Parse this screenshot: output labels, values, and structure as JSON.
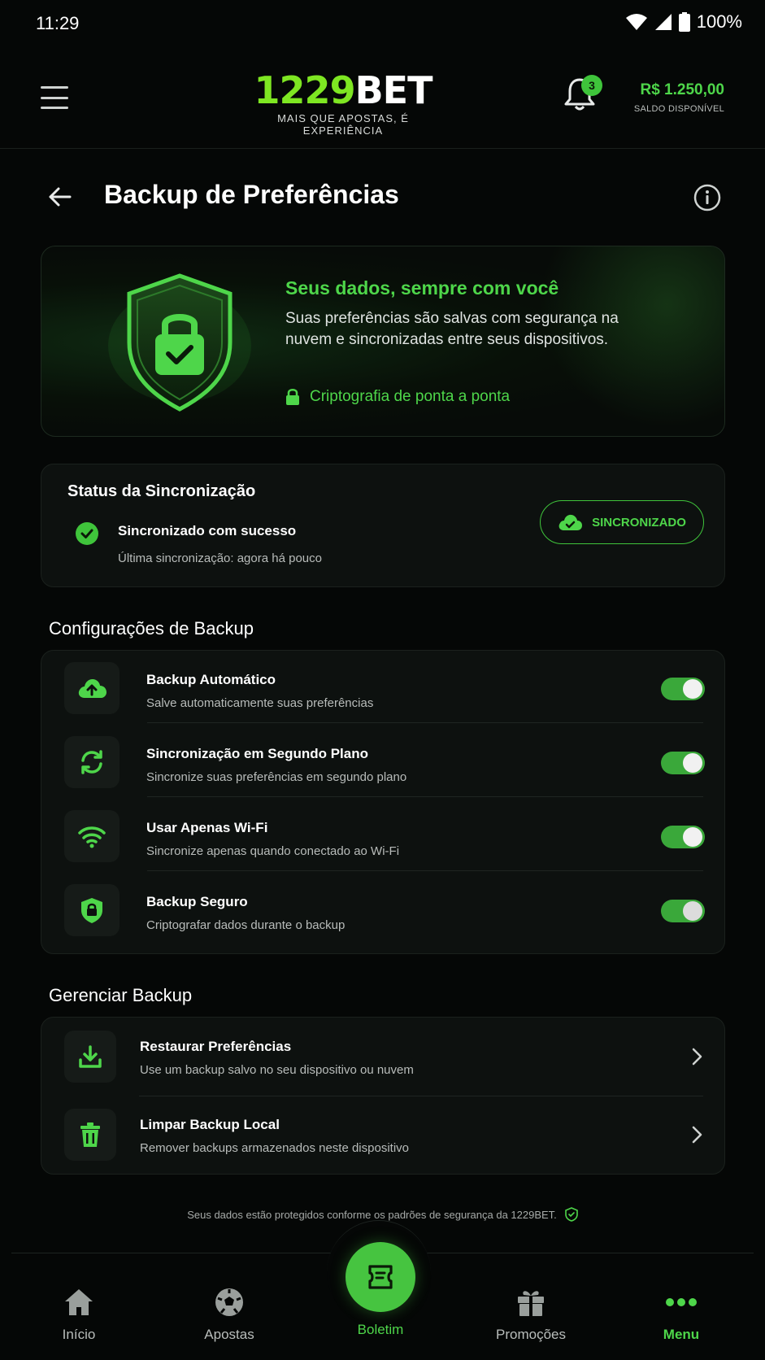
{
  "status_bar": {
    "time": "11:29",
    "battery": "100%"
  },
  "header": {
    "logo_number": "1229",
    "logo_brand": "BET",
    "logo_tagline": "MAIS QUE APOSTAS, É EXPERIÊNCIA",
    "notification_count": "3",
    "balance_amount": "R$ 1.250,00",
    "balance_label": "SALDO DISPONÍVEL"
  },
  "page": {
    "title": "Backup de Preferências"
  },
  "hero": {
    "title": "Seus dados, sempre com você",
    "description": "Suas preferências são salvas com segurança na nuvem e sincronizadas entre seus dispositivos.",
    "encryption": "Criptografia de ponta a ponta"
  },
  "sync": {
    "title": "Status da Sincronização",
    "message": "Sincronizado com sucesso",
    "last_sync": "Última sincronização: agora há pouco",
    "status_pill": "SINCRONIZADO"
  },
  "backup_settings": {
    "heading": "Configurações de Backup",
    "items": [
      {
        "title": "Backup Automático",
        "subtitle": "Salve automaticamente suas preferências",
        "icon": "cloud-upload-icon",
        "enabled": true
      },
      {
        "title": "Sincronização em Segundo Plano",
        "subtitle": "Sincronize suas preferências em segundo plano",
        "icon": "sync-icon",
        "enabled": true
      },
      {
        "title": "Usar Apenas Wi-Fi",
        "subtitle": "Sincronize apenas quando conectado ao Wi-Fi",
        "icon": "wifi-icon",
        "enabled": true
      },
      {
        "title": "Backup Seguro",
        "subtitle": "Criptografar dados durante o backup",
        "icon": "shield-lock-icon",
        "enabled": true
      }
    ]
  },
  "manage_backup": {
    "heading": "Gerenciar Backup",
    "items": [
      {
        "title": "Restaurar Preferências",
        "subtitle": "Use um backup salvo no seu dispositivo ou nuvem",
        "icon": "download-icon"
      },
      {
        "title": "Limpar Backup Local",
        "subtitle": "Remover backups armazenados neste dispositivo",
        "icon": "trash-icon"
      }
    ]
  },
  "footer_note": "Seus dados estão protegidos conforme os padrões de segurança da 1229BET.",
  "bottom_nav": {
    "items": [
      {
        "label": "Início",
        "icon": "home-icon"
      },
      {
        "label": "Apostas",
        "icon": "soccer-ball-icon"
      },
      {
        "label": "Boletim",
        "icon": "ticket-icon"
      },
      {
        "label": "Promoções",
        "icon": "gift-icon"
      },
      {
        "label": "Menu",
        "icon": "more-icon"
      }
    ],
    "active": "Menu"
  },
  "colors": {
    "accent": "#4ed64a",
    "background": "#050706",
    "card": "#0d110f"
  }
}
